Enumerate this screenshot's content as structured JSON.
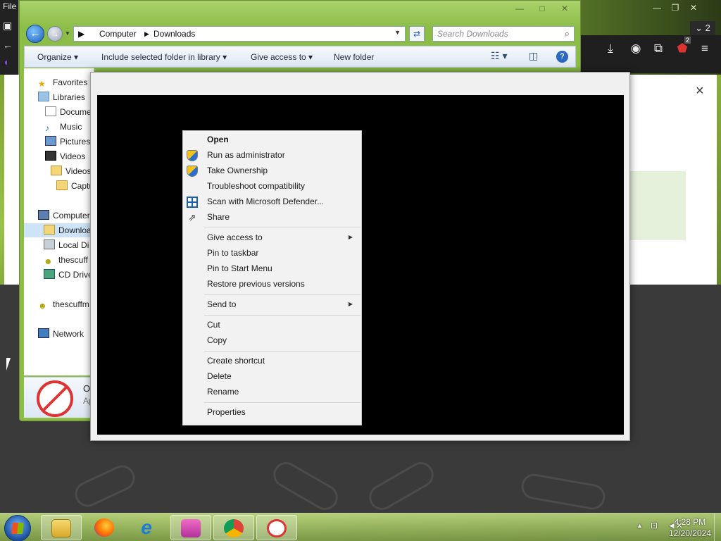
{
  "browser": {
    "menu_file": "File",
    "tab_count": "2",
    "extension_badge": "2",
    "close_symbol": "×"
  },
  "explorer": {
    "breadcrumb": [
      "Computer",
      "Downloads"
    ],
    "search_placeholder": "Search Downloads",
    "commands": {
      "organize": "Organize",
      "include_library": "Include selected folder in library",
      "give_access": "Give access to",
      "new_folder": "New folder"
    },
    "nav": {
      "favorites": "Favorites",
      "libraries": "Libraries",
      "documents": "Docume",
      "music": "Music",
      "pictures": "Pictures",
      "videos": "Videos",
      "videos_sub": "Videos",
      "captures": "Captu",
      "computer": "Computer",
      "downloads": "Downloa",
      "local_disk": "Local Di",
      "thescuff_drive": "thescuff",
      "cd_drive": "CD Drive",
      "thescuff_user": "thescuffm",
      "network": "Network"
    },
    "details": {
      "name_fragment": "O",
      "type_fragment": "Ap"
    }
  },
  "context_menu": {
    "groups": [
      [
        {
          "label": "Open",
          "bold": true,
          "icon": ""
        },
        {
          "label": "Run as administrator",
          "icon": "uac-shield-icon"
        },
        {
          "label": "Take Ownership",
          "icon": "uac-shield-icon"
        },
        {
          "label": "Troubleshoot compatibility",
          "icon": ""
        },
        {
          "label": "Scan with Microsoft Defender...",
          "icon": "defender-icon"
        },
        {
          "label": "Share",
          "icon": "share-icon"
        }
      ],
      [
        {
          "label": "Give access to",
          "submenu": true
        },
        {
          "label": "Pin to taskbar"
        },
        {
          "label": "Pin to Start Menu"
        },
        {
          "label": "Restore previous versions"
        }
      ],
      [
        {
          "label": "Send to",
          "submenu": true
        }
      ],
      [
        {
          "label": "Cut"
        },
        {
          "label": "Copy"
        }
      ],
      [
        {
          "label": "Create shortcut"
        },
        {
          "label": "Delete"
        },
        {
          "label": "Rename"
        }
      ],
      [
        {
          "label": "Properties"
        }
      ]
    ]
  },
  "taskbar": {
    "items": [
      "explorer-icon",
      "firefox-icon",
      "internet-explorer-icon",
      "cat-app-icon",
      "chrome-icon",
      "security-app-icon"
    ],
    "time": "4:28 PM",
    "date": "12/20/2024"
  }
}
